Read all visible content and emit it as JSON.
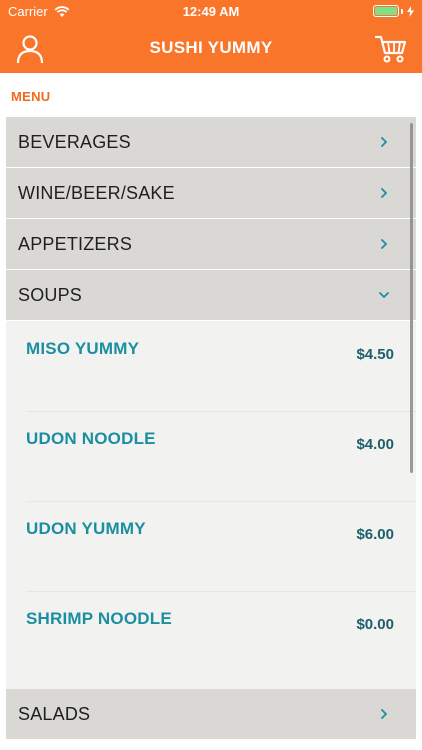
{
  "status_bar": {
    "carrier": "Carrier",
    "time": "12:49 AM",
    "battery_level": 1.0
  },
  "nav": {
    "title": "SUSHI YUMMY",
    "left_icon": "user-icon",
    "right_icon": "cart-icon"
  },
  "colors": {
    "brand": "#f97529",
    "section_label": "#f26a1b",
    "item_name": "#1b8fa1",
    "item_price": "#1e5f6b",
    "category_bg": "#d9d8d4",
    "chevron": "#1b8fa1"
  },
  "section_label": "MENU",
  "categories_before": [
    {
      "label": "BEVERAGES",
      "expanded": false
    },
    {
      "label": "WINE/BEER/SAKE",
      "expanded": false
    },
    {
      "label": "APPETIZERS",
      "expanded": false
    },
    {
      "label": "SOUPS",
      "expanded": true
    }
  ],
  "soups_items": [
    {
      "name": "MISO YUMMY",
      "price": "$4.50"
    },
    {
      "name": "UDON NOODLE",
      "price": "$4.00"
    },
    {
      "name": "UDON YUMMY",
      "price": "$6.00"
    },
    {
      "name": "SHRIMP NOODLE",
      "price": "$0.00"
    }
  ],
  "categories_after": [
    {
      "label": "SALADS",
      "expanded": false
    }
  ]
}
